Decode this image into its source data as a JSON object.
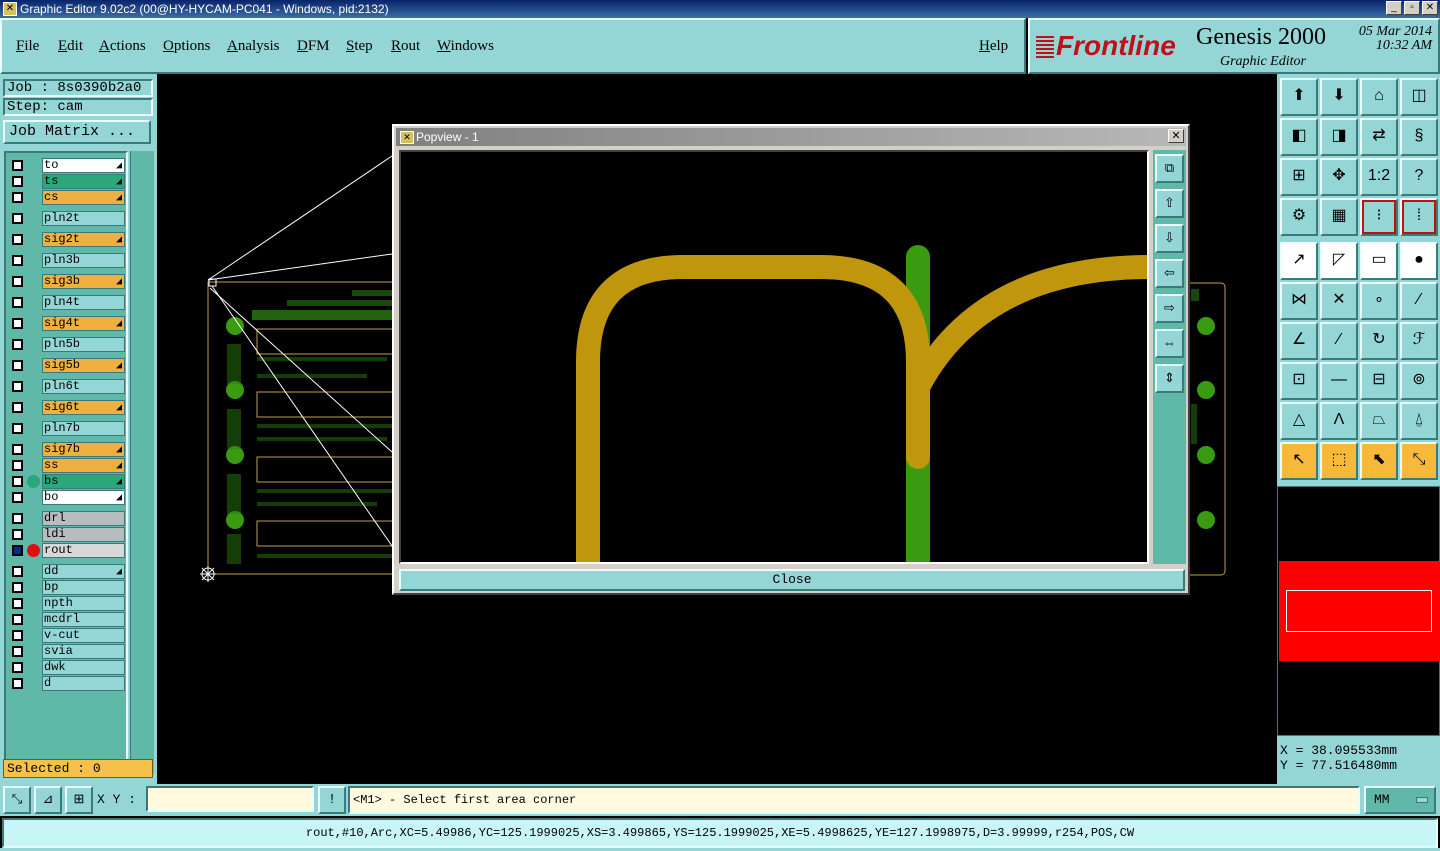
{
  "window": {
    "title": "Graphic Editor 9.02c2 (00@HY-HYCAM-PC041 - Windows, pid:2132)"
  },
  "menu": [
    "File",
    "Edit",
    "Actions",
    "Options",
    "Analysis",
    "DFM",
    "Step",
    "Rout",
    "Windows"
  ],
  "help": "Help",
  "brand": {
    "logo": "Frontline",
    "product": "Genesis 2000",
    "subtitle": "Graphic Editor",
    "date": "05 Mar 2014",
    "time": "10:32 AM"
  },
  "job": "Job : 8s0390b2a0",
  "step": "Step: cam",
  "job_matrix": "Job Matrix ...",
  "layers": [
    {
      "name": "to",
      "color": "#ffffff",
      "arrow": true
    },
    {
      "name": "ts",
      "color": "#2ba87a",
      "arrow": true
    },
    {
      "name": "cs",
      "color": "#f0b040",
      "arrow": true
    },
    {
      "name": "pln2t",
      "color": "#94d6d6",
      "arrow": false
    },
    {
      "name": "sig2t",
      "color": "#f0b040",
      "arrow": true
    },
    {
      "name": "pln3b",
      "color": "#94d6d6",
      "arrow": false
    },
    {
      "name": "sig3b",
      "color": "#f0b040",
      "arrow": true
    },
    {
      "name": "pln4t",
      "color": "#94d6d6",
      "arrow": false
    },
    {
      "name": "sig4t",
      "color": "#f0b040",
      "arrow": true
    },
    {
      "name": "pln5b",
      "color": "#94d6d6",
      "arrow": false
    },
    {
      "name": "sig5b",
      "color": "#f0b040",
      "arrow": true
    },
    {
      "name": "pln6t",
      "color": "#94d6d6",
      "arrow": false
    },
    {
      "name": "sig6t",
      "color": "#f0b040",
      "arrow": true
    },
    {
      "name": "pln7b",
      "color": "#94d6d6",
      "arrow": false
    },
    {
      "name": "sig7b",
      "color": "#f0b040",
      "arrow": true
    },
    {
      "name": "ss",
      "color": "#f0b040",
      "arrow": true
    },
    {
      "name": "bs",
      "color": "#2ba87a",
      "arrow": true
    },
    {
      "name": "bo",
      "color": "#ffffff",
      "arrow": true
    },
    {
      "name": "drl",
      "color": "#b8bcbe",
      "arrow": false
    },
    {
      "name": "ldi",
      "color": "#b8bcbe",
      "arrow": false
    },
    {
      "name": "rout",
      "color": "#d8d8d8",
      "arrow": false
    },
    {
      "name": "dd",
      "color": "#94d6d6",
      "arrow": true
    },
    {
      "name": "bp",
      "color": "#94d6d6",
      "arrow": false
    },
    {
      "name": "npth",
      "color": "#94d6d6",
      "arrow": false
    },
    {
      "name": "mcdrl",
      "color": "#94d6d6",
      "arrow": false
    },
    {
      "name": "v-cut",
      "color": "#94d6d6",
      "arrow": false
    },
    {
      "name": "svia",
      "color": "#94d6d6",
      "arrow": false
    },
    {
      "name": "dwk",
      "color": "#94d6d6",
      "arrow": false
    },
    {
      "name": "d",
      "color": "#94d6d6",
      "arrow": false
    }
  ],
  "selected": "Selected : 0",
  "popview": {
    "title": "Popview - 1",
    "close": "Close"
  },
  "toolbox_labels": {
    "ratio": "1:2",
    "help": "?"
  },
  "coords": {
    "x": "X = 38.095533mm",
    "y": "Y = 77.516480mm"
  },
  "xy_label": "X Y :",
  "xy_value": "",
  "prompt": "<M1> - Select first area corner",
  "units": "MM",
  "status": "rout,#10,Arc,XC=5.49986,YC=125.1999025,XS=3.499865,YS=125.1999025,XE=5.4998625,YE=127.1998975,D=3.99999,r254,POS,CW",
  "colors": {
    "accent": "#94d6d6",
    "trace_gold": "#c0960c",
    "trace_green": "#3a9a10",
    "highlight_red": "#ff0000",
    "selected_bg": "#f6c14a"
  }
}
